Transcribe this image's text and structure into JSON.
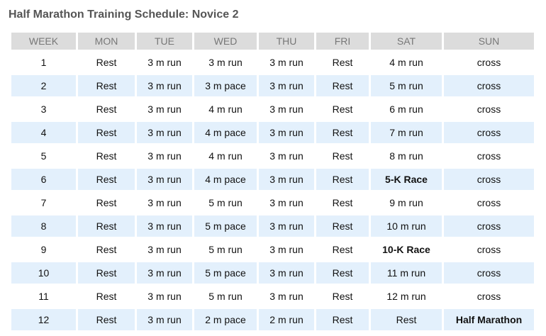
{
  "title": "Half Marathon Training Schedule: Novice 2",
  "columns": [
    "WEEK",
    "MON",
    "TUE",
    "WED",
    "THU",
    "FRI",
    "SAT",
    "SUN"
  ],
  "rows": [
    [
      "1",
      "Rest",
      "3 m run",
      "3 m run",
      "3 m run",
      "Rest",
      "4 m run",
      "cross"
    ],
    [
      "2",
      "Rest",
      "3 m run",
      "3 m pace",
      "3 m run",
      "Rest",
      "5 m run",
      "cross"
    ],
    [
      "3",
      "Rest",
      "3 m run",
      "4 m run",
      "3 m run",
      "Rest",
      "6 m run",
      "cross"
    ],
    [
      "4",
      "Rest",
      "3 m run",
      "4 m pace",
      "3 m run",
      "Rest",
      "7 m run",
      "cross"
    ],
    [
      "5",
      "Rest",
      "3 m run",
      "4 m run",
      "3 m run",
      "Rest",
      "8 m run",
      "cross"
    ],
    [
      "6",
      "Rest",
      "3 m run",
      "4 m pace",
      "3 m run",
      "Rest",
      "5-K Race",
      "cross"
    ],
    [
      "7",
      "Rest",
      "3 m run",
      "5 m run",
      "3 m run",
      "Rest",
      "9 m run",
      "cross"
    ],
    [
      "8",
      "Rest",
      "3 m run",
      "5 m pace",
      "3 m run",
      "Rest",
      "10 m run",
      "cross"
    ],
    [
      "9",
      "Rest",
      "3 m run",
      "5 m run",
      "3 m run",
      "Rest",
      "10-K Race",
      "cross"
    ],
    [
      "10",
      "Rest",
      "3 m run",
      "5 m pace",
      "3 m run",
      "Rest",
      "11 m run",
      "cross"
    ],
    [
      "11",
      "Rest",
      "3 m run",
      "5 m run",
      "3 m run",
      "Rest",
      "12 m run",
      "cross"
    ],
    [
      "12",
      "Rest",
      "3 m run",
      "2 m pace",
      "2 m run",
      "Rest",
      "Rest",
      "Half Marathon"
    ]
  ],
  "bold_cells": [
    "5-K Race",
    "10-K Race",
    "Half Marathon"
  ],
  "colors": {
    "header_bg": "#dcdcdc",
    "header_text": "#777777",
    "alt_row_bg": "#e3f0fc",
    "title_text": "#555555"
  }
}
